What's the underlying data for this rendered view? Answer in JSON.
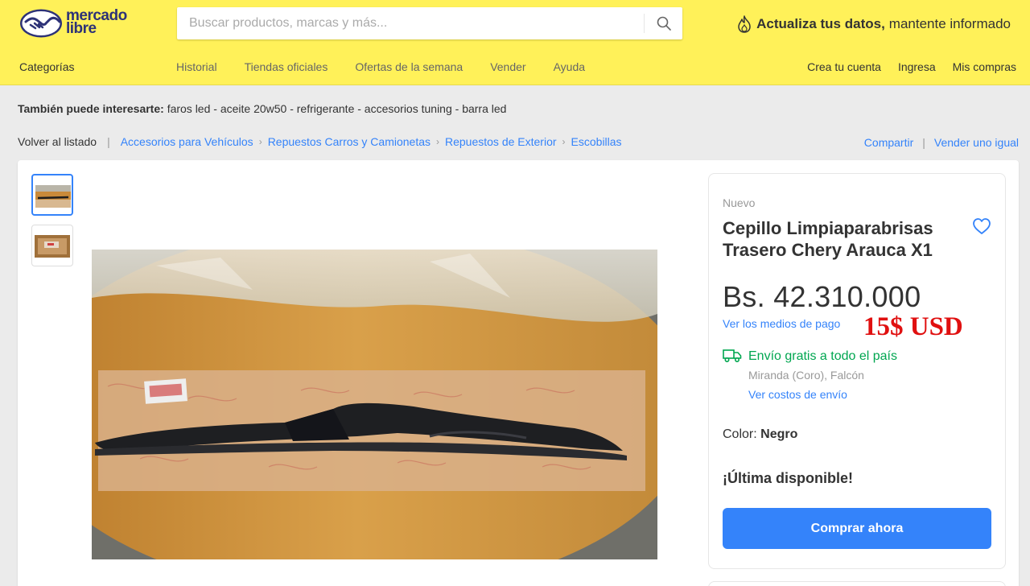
{
  "header": {
    "logo_line1": "mercado",
    "logo_line2": "libre",
    "search_placeholder": "Buscar productos, marcas y más...",
    "promo_bold": "Actualiza tus datos,",
    "promo_text": "mantente informado",
    "categories": "Categorías",
    "nav": [
      "Historial",
      "Tiendas oficiales",
      "Ofertas de la semana",
      "Vender",
      "Ayuda"
    ],
    "account": [
      "Crea tu cuenta",
      "Ingresa",
      "Mis compras"
    ]
  },
  "interest": {
    "label": "También puede interesarte:",
    "items": "faros led - aceite 20w50 - refrigerante - accesorios tuning - barra led"
  },
  "breadcrumb": {
    "back": "Volver al listado",
    "items": [
      "Accesorios para Vehículos",
      "Repuestos Carros y Camionetas",
      "Repuestos de Exterior",
      "Escobillas"
    ]
  },
  "share": {
    "share_label": "Compartir",
    "sell_label": "Vender uno igual"
  },
  "product": {
    "condition": "Nuevo",
    "title": "Cepillo Limpiaparabrisas Trasero Chery Arauca X1",
    "price": "Bs. 42.310.000",
    "payment_link": "Ver los medios de pago",
    "usd_overlay": "15$ USD",
    "shipping_main": "Envío gratis a todo el país",
    "shipping_location": "Miranda (Coro), Falcón",
    "shipping_cost_link": "Ver costos de envío",
    "color_label": "Color:",
    "color_value": "Negro",
    "stock": "¡Última disponible!",
    "buy_button": "Comprar ahora"
  },
  "colors": {
    "header_bg": "#fff159",
    "accent": "#3483fa",
    "shipping_green": "#00a650",
    "overlay_red": "#e01010"
  },
  "icons": [
    "mercadolibre-logo-icon",
    "search-icon",
    "flame-icon",
    "heart-icon",
    "truck-icon"
  ]
}
